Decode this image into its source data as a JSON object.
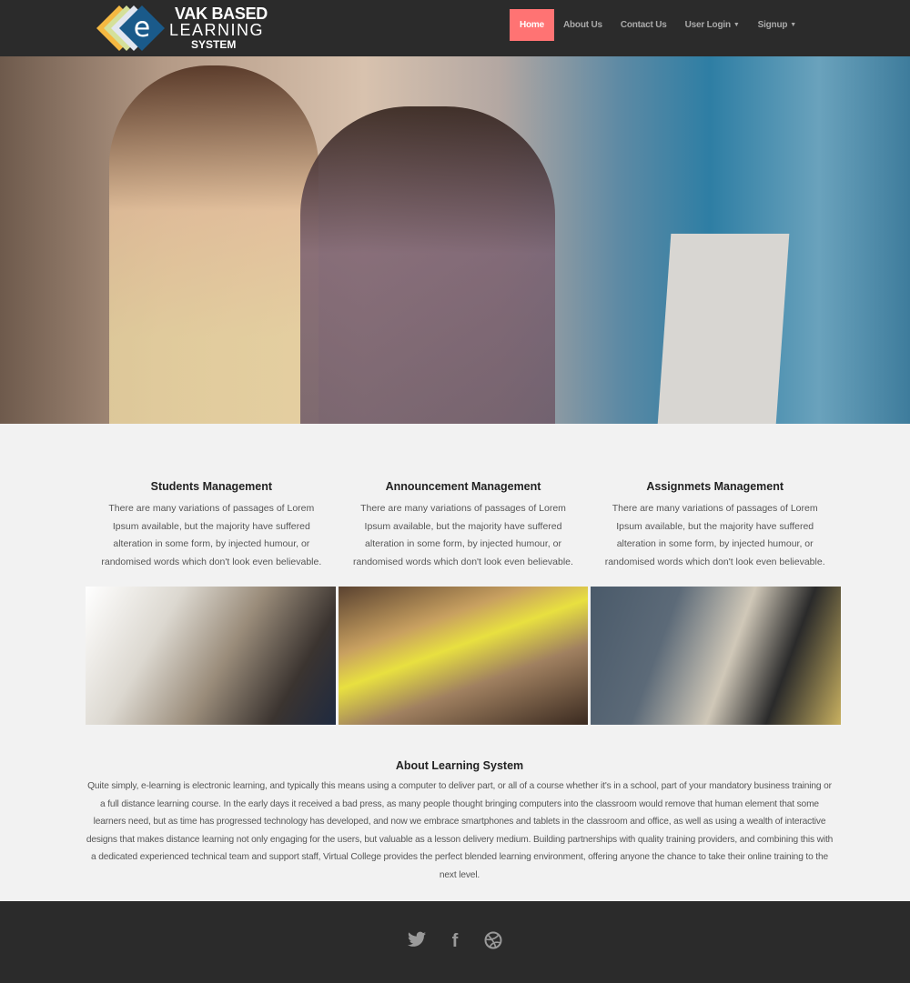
{
  "brand": {
    "line1": "VAK BASED",
    "line2": "LEARNING",
    "line3": "SYSTEM",
    "letter": "e"
  },
  "nav": [
    {
      "label": "Home",
      "active": true
    },
    {
      "label": "About Us"
    },
    {
      "label": "Contact Us"
    },
    {
      "label": "User Login",
      "dropdown": true
    },
    {
      "label": "Signup",
      "dropdown": true
    }
  ],
  "accent": "#ff7373",
  "features": [
    {
      "title": "Students Management",
      "text": "There are many variations of passages of Lorem Ipsum available, but the majority have suffered alteration in some form, by injected humour, or randomised words which don't look even believable."
    },
    {
      "title": "Announcement Management",
      "text": "There are many variations of passages of Lorem Ipsum available, but the majority have suffered alteration in some form, by injected humour, or randomised words which don't look even believable."
    },
    {
      "title": "Assignmets Management",
      "text": "There are many variations of passages of Lorem Ipsum available, but the majority have suffered alteration in some form, by injected humour, or randomised words which don't look even believable."
    }
  ],
  "about": {
    "title": "About Learning System",
    "text": "Quite simply, e-learning is electronic learning, and typically this means using a computer to deliver part, or all of a course whether it's in a school, part of your mandatory business training or a full distance learning course. In the early days it received a bad press, as many people thought bringing computers into the classroom would remove that human element that some learners need, but as time has progressed technology has developed, and now we embrace smartphones and tablets in the classroom and office, as well as using a wealth of interactive designs that makes distance learning not only engaging for the users, but valuable as a lesson delivery medium. Building partnerships with quality training providers, and combining this with a dedicated experienced technical team and support staff, Virtual College provides the perfect blended learning environment, offering anyone the chance to take their online training to the next level."
  },
  "social": [
    "twitter-icon",
    "facebook-icon",
    "dribbble-icon"
  ]
}
